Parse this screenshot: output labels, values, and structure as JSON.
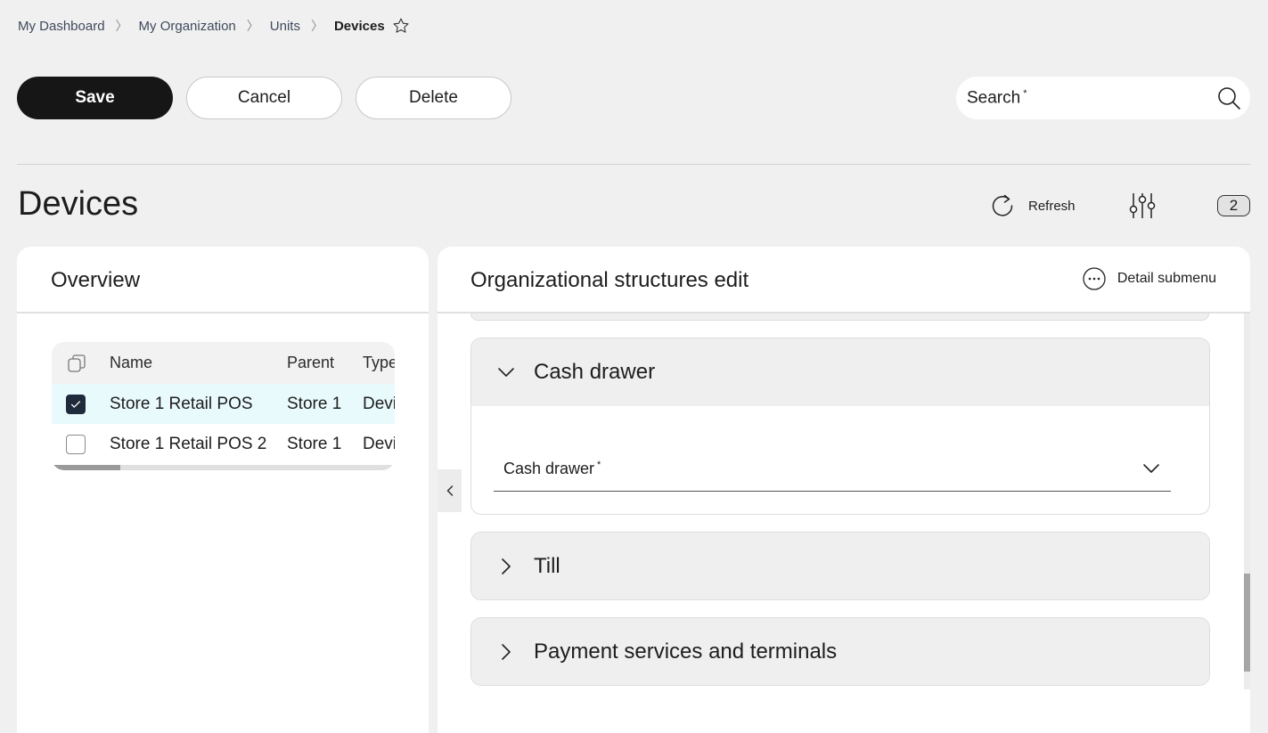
{
  "breadcrumb": {
    "items": [
      "My Dashboard",
      "My Organization",
      "Units"
    ],
    "current": "Devices",
    "separator": "〉"
  },
  "toolbar": {
    "save_label": "Save",
    "cancel_label": "Cancel",
    "delete_label": "Delete"
  },
  "search": {
    "label": "Search",
    "required_mark": "*"
  },
  "page": {
    "title": "Devices",
    "refresh_label": "Refresh",
    "count": "2"
  },
  "overview": {
    "title": "Overview",
    "columns": [
      "Name",
      "Parent",
      "Type"
    ],
    "rows": [
      {
        "name": "Store 1 Retail POS",
        "parent": "Store 1",
        "type": "Device",
        "checked": true
      },
      {
        "name": "Store 1 Retail POS 2",
        "parent": "Store 1",
        "type": "Device",
        "checked": false
      }
    ],
    "horizontal_scroll_fraction": 0.2
  },
  "detail": {
    "title": "Organizational structures edit",
    "submenu_label": "Detail submenu",
    "sections": [
      {
        "title": "Cash drawer",
        "expanded": true,
        "field_label": "Cash drawer",
        "required_mark": "*"
      },
      {
        "title": "Till",
        "expanded": false
      },
      {
        "title": "Payment services and terminals",
        "expanded": false
      }
    ]
  },
  "colors": {
    "background": "#f0f0f0",
    "primary_button": "#161616",
    "selected_row": "#e9fafd",
    "checkbox_checked": "#1f2a3a"
  },
  "icons": {
    "favorite": "star-outline-icon",
    "search": "magnifier-icon",
    "refresh": "refresh-icon",
    "filter": "sliders-icon",
    "submenu": "ellipsis-circle-icon",
    "collapse": "chevron-left-icon"
  }
}
